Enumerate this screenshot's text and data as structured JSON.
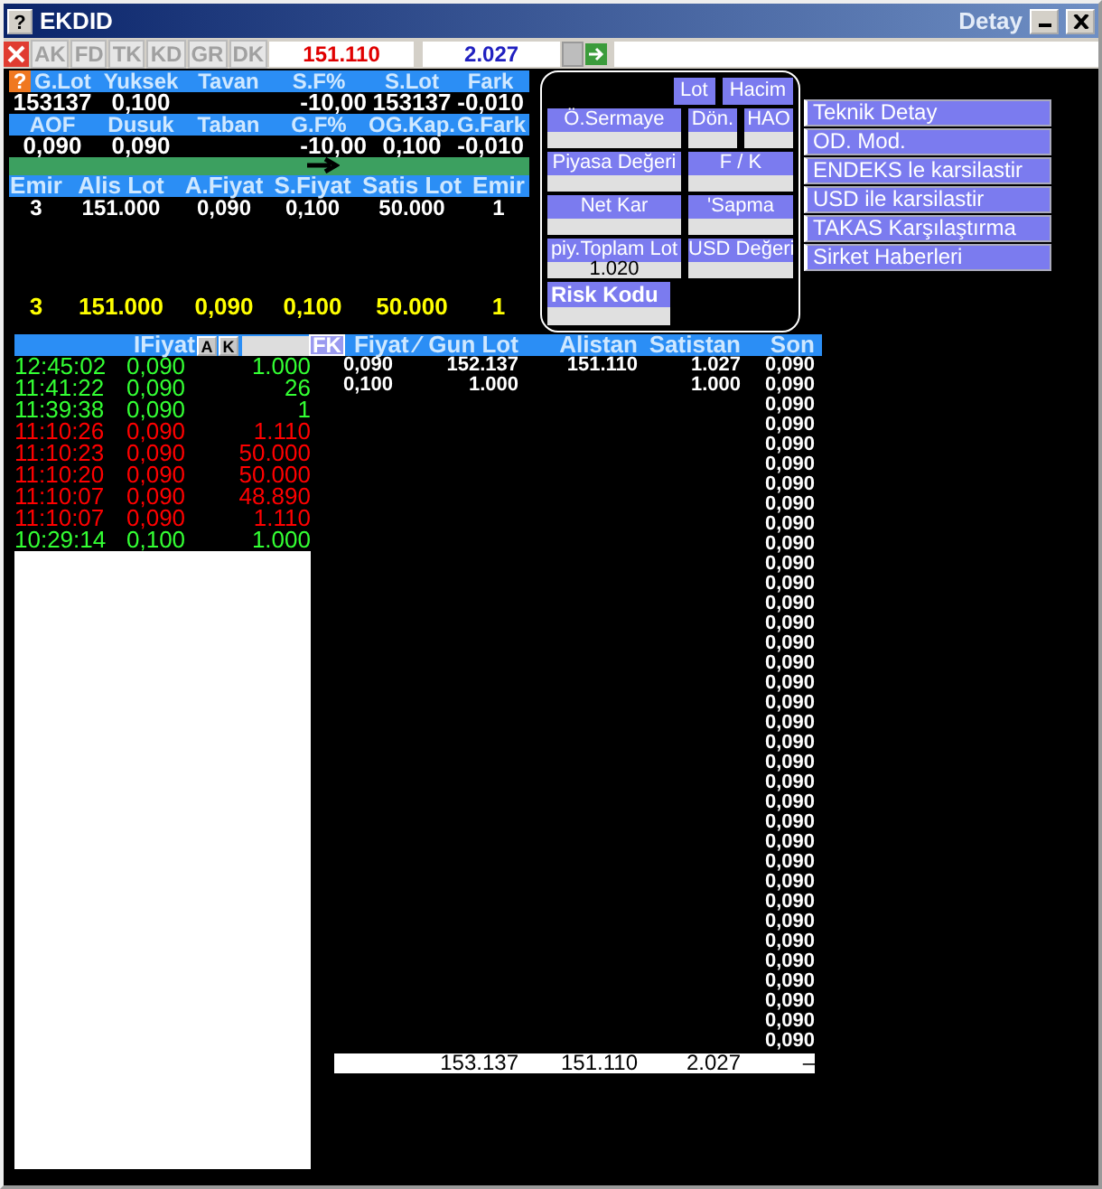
{
  "window": {
    "title": "EKDID",
    "subtitle": "Detay",
    "help": "?"
  },
  "toolbar": {
    "tabs": [
      {
        "label": "AK"
      },
      {
        "label": "FD"
      },
      {
        "label": "TK"
      },
      {
        "label": "KD"
      },
      {
        "label": "GR"
      },
      {
        "label": "DK"
      }
    ],
    "last": "151.110",
    "change": "2.027"
  },
  "summary": {
    "help": "?",
    "groups": [
      {
        "cells": [
          {
            "header": "G.Lot",
            "value": "153137"
          },
          {
            "header": "Yuksek",
            "value": "0,100"
          },
          {
            "header": "Tavan"
          },
          {
            "header": "S.F%",
            "value": "-10,00"
          },
          {
            "header": "S.Lot",
            "value": "153137"
          },
          {
            "header": "Fark",
            "value": "-0,010"
          }
        ]
      },
      {
        "cells": [
          {
            "header": "AOF",
            "value": "0,090"
          },
          {
            "header": "Dusuk",
            "value": "0,090"
          },
          {
            "header": "Taban"
          },
          {
            "header": "G.F%",
            "value": "-10,00"
          },
          {
            "header": "OG.Kap.",
            "value": "0,100"
          },
          {
            "header": "G.Fark",
            "value": "-0,010"
          }
        ]
      }
    ]
  },
  "depth": {
    "columns": [
      "Emir",
      "Alis Lot",
      "A.Fiyat",
      "S.Fiyat",
      "Satis Lot",
      "Emir"
    ],
    "rows": [
      [
        "3",
        "151.000",
        "0,090",
        "0,100",
        "50.000",
        "1"
      ]
    ],
    "total": [
      "3",
      "151.000",
      "0,090",
      "0,100",
      "50.000",
      "1"
    ]
  },
  "info_panel": {
    "toggles": [
      "Lot",
      "Hacim"
    ],
    "rows": [
      [
        {
          "label": "Ö.Sermaye"
        },
        {
          "label": "Dön."
        },
        {
          "label": "HAO"
        }
      ],
      [
        {
          "label": "Piyasa Değeri"
        },
        {
          "label": "F / K"
        }
      ],
      [
        {
          "label": "Net Kar"
        },
        {
          "label": "'Sapma"
        }
      ],
      [
        {
          "label": "piy.Toplam Lot",
          "value": "1.020"
        },
        {
          "label": "USD Değeri"
        }
      ]
    ],
    "risk": {
      "label": "Risk Kodu"
    }
  },
  "links": [
    "Teknik Detay",
    "OD. Mod.",
    "ENDEKS le karsilastir",
    "USD ile karsilastir",
    "TAKAS Karşılaştırma",
    "Sirket Haberleri"
  ],
  "trades": {
    "header": "IFiyat",
    "buttons": [
      "A",
      "K"
    ],
    "fk": "FK",
    "rows": [
      {
        "time": "12:45:02",
        "price": "0,090",
        "lot": "1.000",
        "color": "#33ff33"
      },
      {
        "time": "11:41:22",
        "price": "0,090",
        "lot": "26",
        "color": "#33ff33"
      },
      {
        "time": "11:39:38",
        "price": "0,090",
        "lot": "1",
        "color": "#33ff33"
      },
      {
        "time": "11:10:26",
        "price": "0,090",
        "lot": "1.110",
        "color": "#ff0000"
      },
      {
        "time": "11:10:23",
        "price": "0,090",
        "lot": "50.000",
        "color": "#ff0000"
      },
      {
        "time": "11:10:20",
        "price": "0,090",
        "lot": "50.000",
        "color": "#ff0000"
      },
      {
        "time": "11:10:07",
        "price": "0,090",
        "lot": "48.890",
        "color": "#ff0000"
      },
      {
        "time": "11:10:07",
        "price": "0,090",
        "lot": "1.110",
        "color": "#ff0000"
      },
      {
        "time": "10:29:14",
        "price": "0,100",
        "lot": "1.000",
        "color": "#33ff33"
      }
    ]
  },
  "table": {
    "columns": [
      "Fiyat ⁄",
      "Gun Lot",
      "Alistan",
      "Satistan",
      "Son"
    ],
    "rows": [
      {
        "fiyat": "0,090",
        "gun_lot": "152.137",
        "alistan": "151.110",
        "satistan": "1.027",
        "son": "0,090"
      },
      {
        "fiyat": "0,100",
        "gun_lot": "1.000",
        "satistan": "1.000",
        "son": "0,090"
      },
      {
        "son": "0,090"
      },
      {
        "son": "0,090"
      },
      {
        "son": "0,090"
      },
      {
        "son": "0,090"
      },
      {
        "son": "0,090"
      },
      {
        "son": "0,090"
      },
      {
        "son": "0,090"
      },
      {
        "son": "0,090"
      },
      {
        "son": "0,090"
      },
      {
        "son": "0,090"
      },
      {
        "son": "0,090"
      },
      {
        "son": "0,090"
      },
      {
        "son": "0,090"
      },
      {
        "son": "0,090"
      },
      {
        "son": "0,090"
      },
      {
        "son": "0,090"
      },
      {
        "son": "0,090"
      },
      {
        "son": "0,090"
      },
      {
        "son": "0,090"
      },
      {
        "son": "0,090"
      },
      {
        "son": "0,090"
      },
      {
        "son": "0,090"
      },
      {
        "son": "0,090"
      },
      {
        "son": "0,090"
      },
      {
        "son": "0,090"
      },
      {
        "son": "0,090"
      },
      {
        "son": "0,090"
      },
      {
        "son": "0,090"
      },
      {
        "son": "0,090"
      },
      {
        "son": "0,090"
      },
      {
        "son": "0,090"
      },
      {
        "son": "0,090"
      },
      {
        "son": "0,090"
      }
    ],
    "total": {
      "gun_lot": "153.137",
      "alistan": "151.110",
      "satistan": "2.027",
      "son": "–"
    }
  }
}
